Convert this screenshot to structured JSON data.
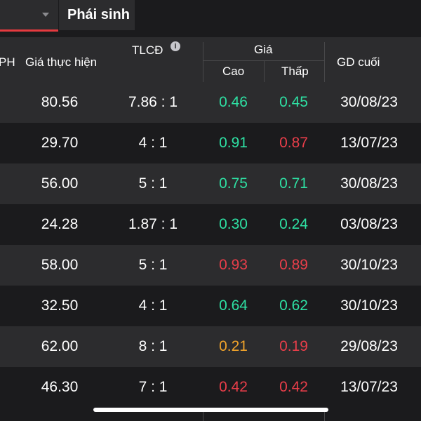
{
  "tabs": {
    "active": "Phái sinh"
  },
  "header": {
    "partial": "PH",
    "strike_price": "Giá thực hiện",
    "ratio": "TLCĐ",
    "price_group": "Giá",
    "high": "Cao",
    "low": "Thấp",
    "last_trade": "GD cuối"
  },
  "colors": {
    "up": "#2ee0a3",
    "down": "#ea3e4a",
    "ref": "#f0a32b"
  },
  "rows": [
    {
      "price": "80.56",
      "ratio": "7.86 : 1",
      "high": "0.46",
      "high_color": "#2ee0a3",
      "low": "0.45",
      "low_color": "#2ee0a3",
      "date": "30/08/23"
    },
    {
      "price": "29.70",
      "ratio": "4 : 1",
      "high": "0.91",
      "high_color": "#2ee0a3",
      "low": "0.87",
      "low_color": "#ea3e4a",
      "date": "13/07/23"
    },
    {
      "price": "56.00",
      "ratio": "5 : 1",
      "high": "0.75",
      "high_color": "#2ee0a3",
      "low": "0.71",
      "low_color": "#2ee0a3",
      "date": "30/08/23"
    },
    {
      "price": "24.28",
      "ratio": "1.87 : 1",
      "high": "0.30",
      "high_color": "#2ee0a3",
      "low": "0.24",
      "low_color": "#2ee0a3",
      "date": "03/08/23"
    },
    {
      "price": "58.00",
      "ratio": "5 : 1",
      "high": "0.93",
      "high_color": "#ea3e4a",
      "low": "0.89",
      "low_color": "#ea3e4a",
      "date": "30/10/23"
    },
    {
      "price": "32.50",
      "ratio": "4 : 1",
      "high": "0.64",
      "high_color": "#2ee0a3",
      "low": "0.62",
      "low_color": "#2ee0a3",
      "date": "30/10/23"
    },
    {
      "price": "62.00",
      "ratio": "8 : 1",
      "high": "0.21",
      "high_color": "#f0a32b",
      "low": "0.19",
      "low_color": "#ea3e4a",
      "date": "29/08/23"
    },
    {
      "price": "46.30",
      "ratio": "7 : 1",
      "high": "0.42",
      "high_color": "#ea3e4a",
      "low": "0.42",
      "low_color": "#ea3e4a",
      "date": "13/07/23"
    }
  ]
}
